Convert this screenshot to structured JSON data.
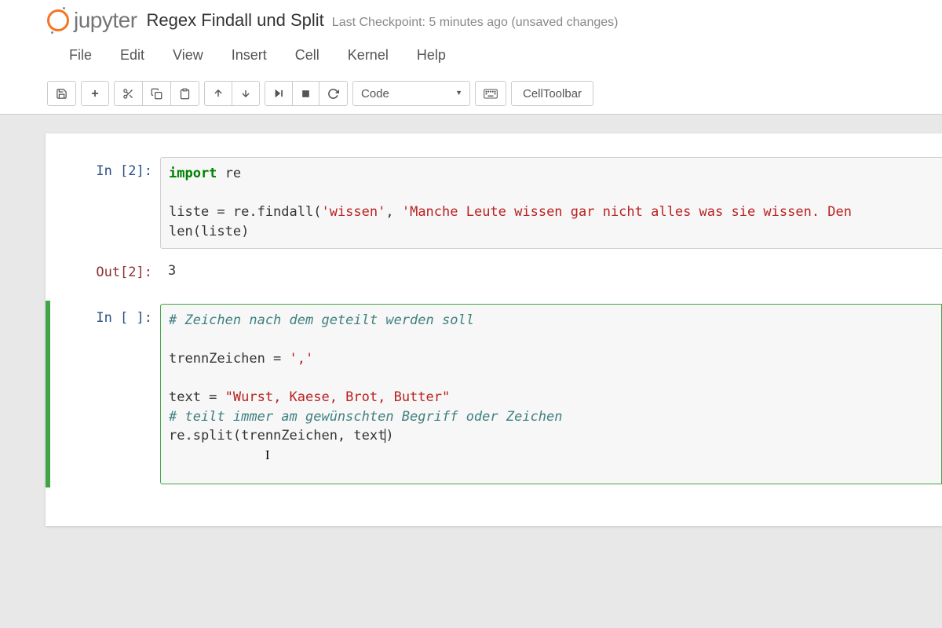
{
  "header": {
    "brand": "jupyter",
    "title": "Regex Findall und Split",
    "checkpoint": "Last Checkpoint: 5 minutes ago (unsaved changes)"
  },
  "menubar": [
    "File",
    "Edit",
    "View",
    "Insert",
    "Cell",
    "Kernel",
    "Help"
  ],
  "toolbar": {
    "celltype_selected": "Code",
    "celltoolbar_label": "CellToolbar"
  },
  "cells": [
    {
      "in_prompt": "In [2]:",
      "out_prompt": "Out[2]:",
      "output": "3",
      "code": {
        "l1_kw": "import",
        "l1_mod": " re",
        "l2a": "liste = re.findall(",
        "l2s1": "'wissen'",
        "l2b": ", ",
        "l2s2": "'Manche Leute wissen gar nicht alles was sie wissen. Den",
        "l3a": "len(liste)"
      }
    },
    {
      "in_prompt": "In [ ]:",
      "code": {
        "c1": "# Zeichen nach dem geteilt werden soll",
        "l1a": "trennZeichen = ",
        "l1s": "','",
        "l2a": "text = ",
        "l2s": "\"Wurst, Kaese, Brot, Butter\"",
        "c2": "# teilt immer am gewünschten Begriff oder Zeichen",
        "l3a": "re.split(trennZeichen, text",
        "l3b": ")"
      }
    }
  ]
}
